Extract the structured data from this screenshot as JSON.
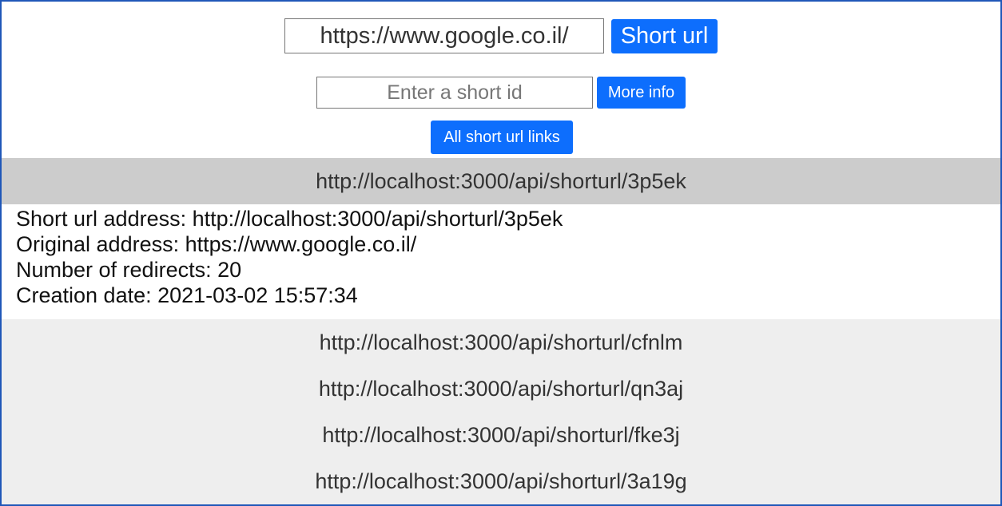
{
  "shorten": {
    "url_value": "https://www.google.co.il/",
    "button_label": "Short url"
  },
  "info": {
    "placeholder": "Enter a short id",
    "button_label": "More info"
  },
  "all_links_button_label": "All short url links",
  "selected_link": "http://localhost:3000/api/shorturl/3p5ek",
  "details": {
    "short_url_line": "Short url address: http://localhost:3000/api/shorturl/3p5ek",
    "original_line": "Original address: https://www.google.co.il/",
    "redirects_line": "Number of redirects: 20",
    "creation_line": "Creation date: 2021-03-02 15:57:34"
  },
  "links": [
    "http://localhost:3000/api/shorturl/cfnlm",
    "http://localhost:3000/api/shorturl/qn3aj",
    "http://localhost:3000/api/shorturl/fke3j",
    "http://localhost:3000/api/shorturl/3a19g"
  ],
  "colors": {
    "accent": "#0d6efd",
    "selected_bg": "#cccccc",
    "list_bg": "#eeeeee",
    "frame_border": "#1f57b8"
  }
}
